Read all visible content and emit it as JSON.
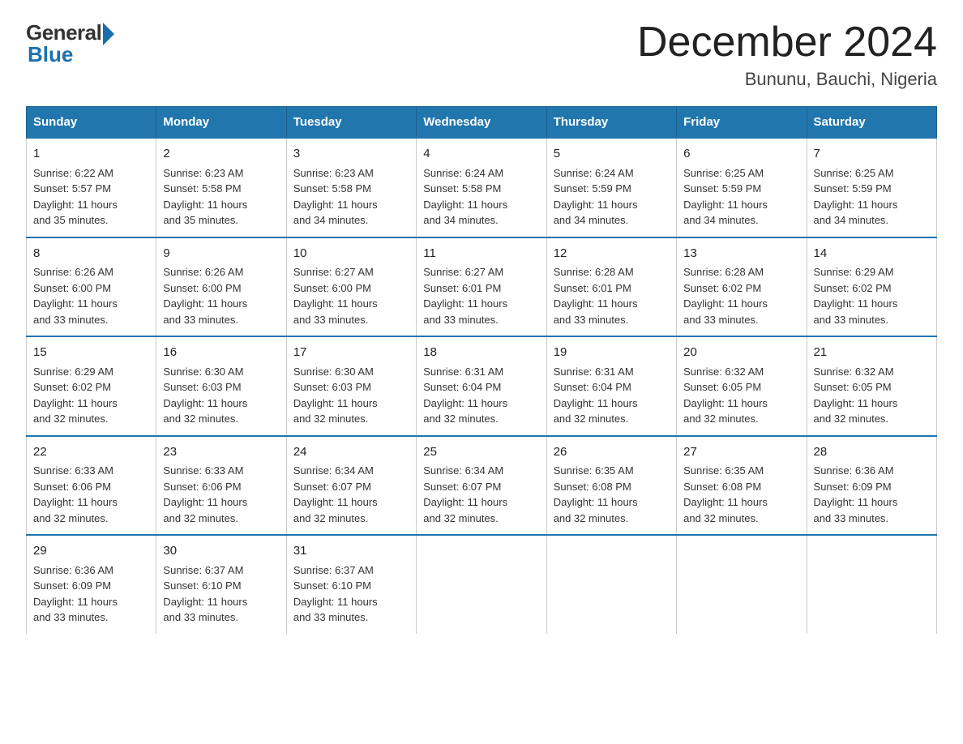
{
  "logo": {
    "general": "General",
    "blue": "Blue"
  },
  "title": "December 2024",
  "subtitle": "Bununu, Bauchi, Nigeria",
  "days_of_week": [
    "Sunday",
    "Monday",
    "Tuesday",
    "Wednesday",
    "Thursday",
    "Friday",
    "Saturday"
  ],
  "weeks": [
    [
      {
        "day": "1",
        "sunrise": "6:22 AM",
        "sunset": "5:57 PM",
        "daylight": "11 hours and 35 minutes."
      },
      {
        "day": "2",
        "sunrise": "6:23 AM",
        "sunset": "5:58 PM",
        "daylight": "11 hours and 35 minutes."
      },
      {
        "day": "3",
        "sunrise": "6:23 AM",
        "sunset": "5:58 PM",
        "daylight": "11 hours and 34 minutes."
      },
      {
        "day": "4",
        "sunrise": "6:24 AM",
        "sunset": "5:58 PM",
        "daylight": "11 hours and 34 minutes."
      },
      {
        "day": "5",
        "sunrise": "6:24 AM",
        "sunset": "5:59 PM",
        "daylight": "11 hours and 34 minutes."
      },
      {
        "day": "6",
        "sunrise": "6:25 AM",
        "sunset": "5:59 PM",
        "daylight": "11 hours and 34 minutes."
      },
      {
        "day": "7",
        "sunrise": "6:25 AM",
        "sunset": "5:59 PM",
        "daylight": "11 hours and 34 minutes."
      }
    ],
    [
      {
        "day": "8",
        "sunrise": "6:26 AM",
        "sunset": "6:00 PM",
        "daylight": "11 hours and 33 minutes."
      },
      {
        "day": "9",
        "sunrise": "6:26 AM",
        "sunset": "6:00 PM",
        "daylight": "11 hours and 33 minutes."
      },
      {
        "day": "10",
        "sunrise": "6:27 AM",
        "sunset": "6:00 PM",
        "daylight": "11 hours and 33 minutes."
      },
      {
        "day": "11",
        "sunrise": "6:27 AM",
        "sunset": "6:01 PM",
        "daylight": "11 hours and 33 minutes."
      },
      {
        "day": "12",
        "sunrise": "6:28 AM",
        "sunset": "6:01 PM",
        "daylight": "11 hours and 33 minutes."
      },
      {
        "day": "13",
        "sunrise": "6:28 AM",
        "sunset": "6:02 PM",
        "daylight": "11 hours and 33 minutes."
      },
      {
        "day": "14",
        "sunrise": "6:29 AM",
        "sunset": "6:02 PM",
        "daylight": "11 hours and 33 minutes."
      }
    ],
    [
      {
        "day": "15",
        "sunrise": "6:29 AM",
        "sunset": "6:02 PM",
        "daylight": "11 hours and 32 minutes."
      },
      {
        "day": "16",
        "sunrise": "6:30 AM",
        "sunset": "6:03 PM",
        "daylight": "11 hours and 32 minutes."
      },
      {
        "day": "17",
        "sunrise": "6:30 AM",
        "sunset": "6:03 PM",
        "daylight": "11 hours and 32 minutes."
      },
      {
        "day": "18",
        "sunrise": "6:31 AM",
        "sunset": "6:04 PM",
        "daylight": "11 hours and 32 minutes."
      },
      {
        "day": "19",
        "sunrise": "6:31 AM",
        "sunset": "6:04 PM",
        "daylight": "11 hours and 32 minutes."
      },
      {
        "day": "20",
        "sunrise": "6:32 AM",
        "sunset": "6:05 PM",
        "daylight": "11 hours and 32 minutes."
      },
      {
        "day": "21",
        "sunrise": "6:32 AM",
        "sunset": "6:05 PM",
        "daylight": "11 hours and 32 minutes."
      }
    ],
    [
      {
        "day": "22",
        "sunrise": "6:33 AM",
        "sunset": "6:06 PM",
        "daylight": "11 hours and 32 minutes."
      },
      {
        "day": "23",
        "sunrise": "6:33 AM",
        "sunset": "6:06 PM",
        "daylight": "11 hours and 32 minutes."
      },
      {
        "day": "24",
        "sunrise": "6:34 AM",
        "sunset": "6:07 PM",
        "daylight": "11 hours and 32 minutes."
      },
      {
        "day": "25",
        "sunrise": "6:34 AM",
        "sunset": "6:07 PM",
        "daylight": "11 hours and 32 minutes."
      },
      {
        "day": "26",
        "sunrise": "6:35 AM",
        "sunset": "6:08 PM",
        "daylight": "11 hours and 32 minutes."
      },
      {
        "day": "27",
        "sunrise": "6:35 AM",
        "sunset": "6:08 PM",
        "daylight": "11 hours and 32 minutes."
      },
      {
        "day": "28",
        "sunrise": "6:36 AM",
        "sunset": "6:09 PM",
        "daylight": "11 hours and 33 minutes."
      }
    ],
    [
      {
        "day": "29",
        "sunrise": "6:36 AM",
        "sunset": "6:09 PM",
        "daylight": "11 hours and 33 minutes."
      },
      {
        "day": "30",
        "sunrise": "6:37 AM",
        "sunset": "6:10 PM",
        "daylight": "11 hours and 33 minutes."
      },
      {
        "day": "31",
        "sunrise": "6:37 AM",
        "sunset": "6:10 PM",
        "daylight": "11 hours and 33 minutes."
      },
      null,
      null,
      null,
      null
    ]
  ],
  "labels": {
    "sunrise": "Sunrise:",
    "sunset": "Sunset:",
    "daylight": "Daylight:"
  }
}
